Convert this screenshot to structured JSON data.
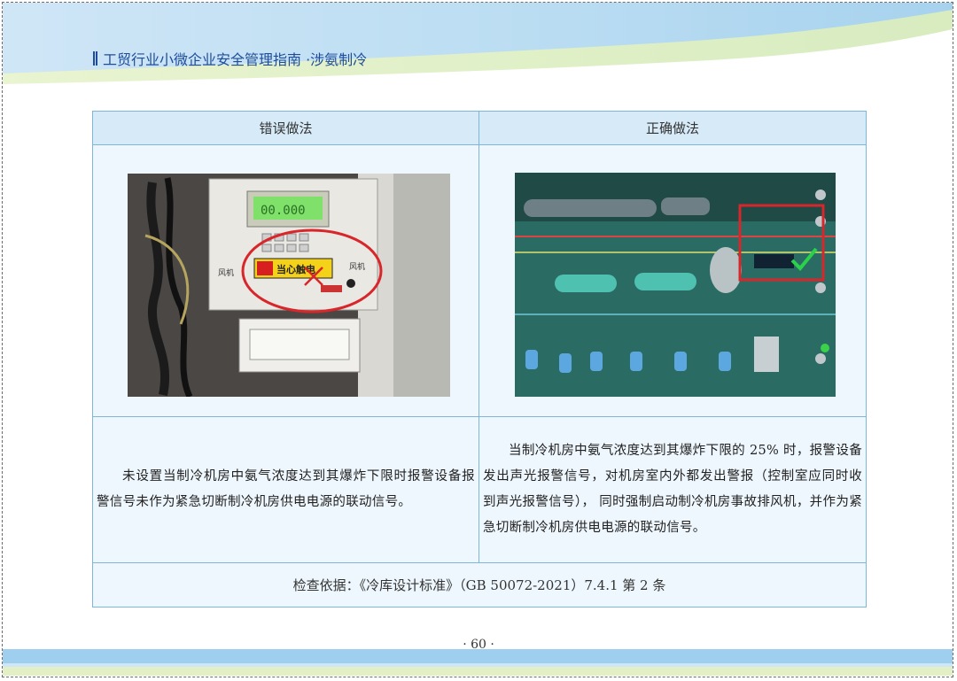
{
  "header": {
    "title": "工贸行业小微企业安全管理指南 ·涉氨制冷"
  },
  "table": {
    "col_wrong_label": "错误做法",
    "col_right_label": "正确做法",
    "wrong_description": "未设置当制冷机房中氨气浓度达到其爆炸下限时报警设备报警信号未作为紧急切断制冷机房供电电源的联动信号。",
    "right_description": "当制冷机房中氨气浓度达到其爆炸下限的 25% 时，报警设备发出声光报警信号，对机房室内外都发出警报（控制室应同时收到声光报警信号）， 同时强制启动制冷机房事故排风机，并作为紧急切断制冷机房供电电源的联动信号。",
    "basis": "检查依据：《冷库设计标准》（GB 50072-2021）7.4.1 第 2 条"
  },
  "photos": {
    "wrong_sign_text": "当心触电",
    "wrong_side_left": "风机",
    "wrong_side_right": "风机",
    "wrong_lcd": "00.000"
  },
  "colors": {
    "header_text": "#1e4c9c",
    "table_border": "#7fb6d8",
    "header_fill": "#d6eaf8",
    "cell_fill": "#eef7fd",
    "mark_wrong": "#d8262b",
    "mark_right": "#2bd14a"
  },
  "page": {
    "number": "· 60 ·"
  }
}
